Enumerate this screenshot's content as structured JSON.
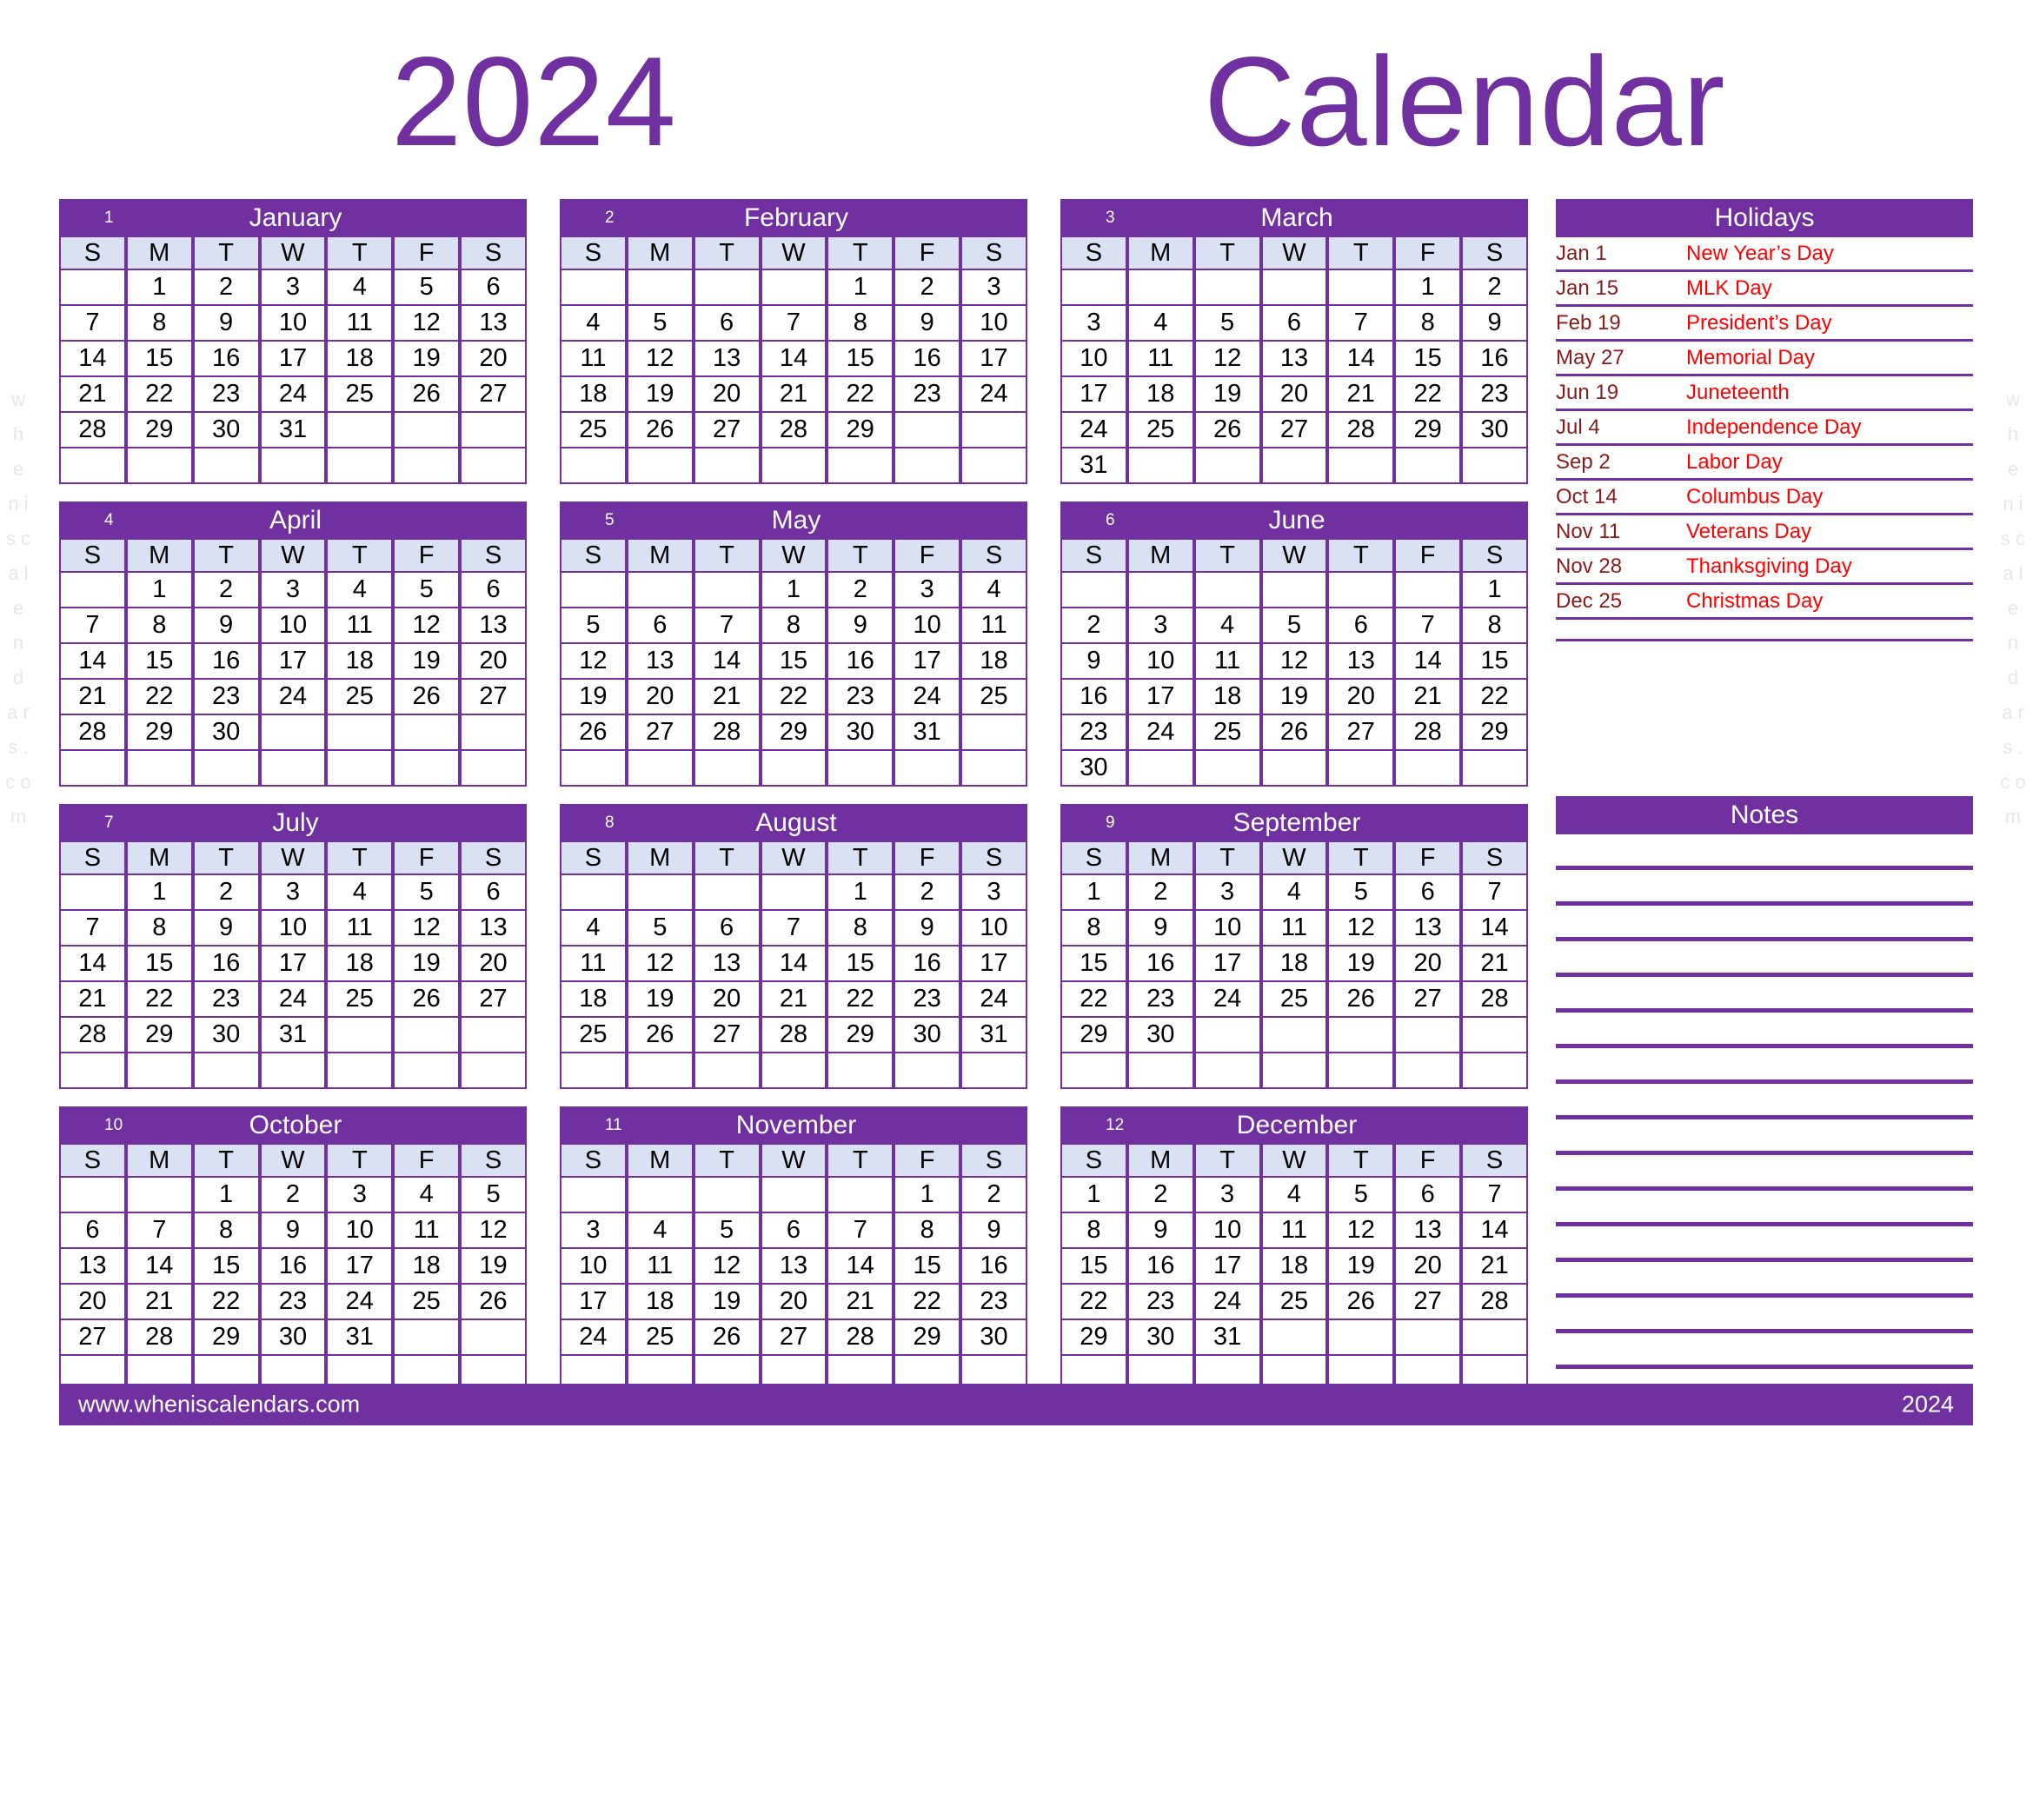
{
  "title": {
    "year": "2024",
    "word": "Calendar"
  },
  "weekdays": [
    "S",
    "M",
    "T",
    "W",
    "T",
    "F",
    "S"
  ],
  "colors": {
    "purple": "#7030A0",
    "weekday_bar": "#D9E1F2",
    "sunday_red": "#FF0000",
    "saturday_blue": "#5B9BD5",
    "holiday_red": "#FF0000",
    "holiday_date": "#8B1A1A"
  },
  "watermark": {
    "left": "w h e n i s c a l e n d a r s . c o m",
    "right": "w h e n i s c a l e n d a r s . c o m"
  },
  "months": [
    {
      "num": "1",
      "name": "January",
      "weeks": [
        [
          "",
          "1",
          "2",
          "3",
          "4",
          "5",
          "6"
        ],
        [
          "7",
          "8",
          "9",
          "10",
          "11",
          "12",
          "13"
        ],
        [
          "14",
          "15",
          "16",
          "17",
          "18",
          "19",
          "20"
        ],
        [
          "21",
          "22",
          "23",
          "24",
          "25",
          "26",
          "27"
        ],
        [
          "28",
          "29",
          "30",
          "31",
          "",
          "",
          ""
        ],
        [
          "",
          "",
          "",
          "",
          "",
          "",
          ""
        ]
      ],
      "holidays": [
        "1",
        "15"
      ]
    },
    {
      "num": "2",
      "name": "February",
      "weeks": [
        [
          "",
          "",
          "",
          "",
          "1",
          "2",
          "3"
        ],
        [
          "4",
          "5",
          "6",
          "7",
          "8",
          "9",
          "10"
        ],
        [
          "11",
          "12",
          "13",
          "14",
          "15",
          "16",
          "17"
        ],
        [
          "18",
          "19",
          "20",
          "21",
          "22",
          "23",
          "24"
        ],
        [
          "25",
          "26",
          "27",
          "28",
          "29",
          "",
          ""
        ],
        [
          "",
          "",
          "",
          "",
          "",
          "",
          ""
        ]
      ],
      "holidays": [
        "19"
      ]
    },
    {
      "num": "3",
      "name": "March",
      "weeks": [
        [
          "",
          "",
          "",
          "",
          "",
          "1",
          "2"
        ],
        [
          "3",
          "4",
          "5",
          "6",
          "7",
          "8",
          "9"
        ],
        [
          "10",
          "11",
          "12",
          "13",
          "14",
          "15",
          "16"
        ],
        [
          "17",
          "18",
          "19",
          "20",
          "21",
          "22",
          "23"
        ],
        [
          "24",
          "25",
          "26",
          "27",
          "28",
          "29",
          "30"
        ],
        [
          "31",
          "",
          "",
          "",
          "",
          "",
          ""
        ]
      ],
      "holidays": []
    },
    {
      "num": "4",
      "name": "April",
      "weeks": [
        [
          "",
          "1",
          "2",
          "3",
          "4",
          "5",
          "6"
        ],
        [
          "7",
          "8",
          "9",
          "10",
          "11",
          "12",
          "13"
        ],
        [
          "14",
          "15",
          "16",
          "17",
          "18",
          "19",
          "20"
        ],
        [
          "21",
          "22",
          "23",
          "24",
          "25",
          "26",
          "27"
        ],
        [
          "28",
          "29",
          "30",
          "",
          "",
          "",
          ""
        ],
        [
          "",
          "",
          "",
          "",
          "",
          "",
          ""
        ]
      ],
      "holidays": []
    },
    {
      "num": "5",
      "name": "May",
      "weeks": [
        [
          "",
          "",
          "",
          "1",
          "2",
          "3",
          "4"
        ],
        [
          "5",
          "6",
          "7",
          "8",
          "9",
          "10",
          "11"
        ],
        [
          "12",
          "13",
          "14",
          "15",
          "16",
          "17",
          "18"
        ],
        [
          "19",
          "20",
          "21",
          "22",
          "23",
          "24",
          "25"
        ],
        [
          "26",
          "27",
          "28",
          "29",
          "30",
          "31",
          ""
        ],
        [
          "",
          "",
          "",
          "",
          "",
          "",
          ""
        ]
      ],
      "holidays": [
        "27"
      ]
    },
    {
      "num": "6",
      "name": "June",
      "weeks": [
        [
          "",
          "",
          "",
          "",
          "",
          "",
          "1"
        ],
        [
          "2",
          "3",
          "4",
          "5",
          "6",
          "7",
          "8"
        ],
        [
          "9",
          "10",
          "11",
          "12",
          "13",
          "14",
          "15"
        ],
        [
          "16",
          "17",
          "18",
          "19",
          "20",
          "21",
          "22"
        ],
        [
          "23",
          "24",
          "25",
          "26",
          "27",
          "28",
          "29"
        ],
        [
          "30",
          "",
          "",
          "",
          "",
          "",
          ""
        ]
      ],
      "holidays": [
        "19"
      ]
    },
    {
      "num": "7",
      "name": "July",
      "weeks": [
        [
          "",
          "1",
          "2",
          "3",
          "4",
          "5",
          "6"
        ],
        [
          "7",
          "8",
          "9",
          "10",
          "11",
          "12",
          "13"
        ],
        [
          "14",
          "15",
          "16",
          "17",
          "18",
          "19",
          "20"
        ],
        [
          "21",
          "22",
          "23",
          "24",
          "25",
          "26",
          "27"
        ],
        [
          "28",
          "29",
          "30",
          "31",
          "",
          "",
          ""
        ],
        [
          "",
          "",
          "",
          "",
          "",
          "",
          ""
        ]
      ],
      "holidays": [
        "4"
      ]
    },
    {
      "num": "8",
      "name": "August",
      "weeks": [
        [
          "",
          "",
          "",
          "",
          "1",
          "2",
          "3"
        ],
        [
          "4",
          "5",
          "6",
          "7",
          "8",
          "9",
          "10"
        ],
        [
          "11",
          "12",
          "13",
          "14",
          "15",
          "16",
          "17"
        ],
        [
          "18",
          "19",
          "20",
          "21",
          "22",
          "23",
          "24"
        ],
        [
          "25",
          "26",
          "27",
          "28",
          "29",
          "30",
          "31"
        ],
        [
          "",
          "",
          "",
          "",
          "",
          "",
          ""
        ]
      ],
      "holidays": []
    },
    {
      "num": "9",
      "name": "September",
      "weeks": [
        [
          "1",
          "2",
          "3",
          "4",
          "5",
          "6",
          "7"
        ],
        [
          "8",
          "9",
          "10",
          "11",
          "12",
          "13",
          "14"
        ],
        [
          "15",
          "16",
          "17",
          "18",
          "19",
          "20",
          "21"
        ],
        [
          "22",
          "23",
          "24",
          "25",
          "26",
          "27",
          "28"
        ],
        [
          "29",
          "30",
          "",
          "",
          "",
          "",
          ""
        ],
        [
          "",
          "",
          "",
          "",
          "",
          "",
          ""
        ]
      ],
      "holidays": [
        "2"
      ]
    },
    {
      "num": "10",
      "name": "October",
      "weeks": [
        [
          "",
          "",
          "1",
          "2",
          "3",
          "4",
          "5"
        ],
        [
          "6",
          "7",
          "8",
          "9",
          "10",
          "11",
          "12"
        ],
        [
          "13",
          "14",
          "15",
          "16",
          "17",
          "18",
          "19"
        ],
        [
          "20",
          "21",
          "22",
          "23",
          "24",
          "25",
          "26"
        ],
        [
          "27",
          "28",
          "29",
          "30",
          "31",
          "",
          ""
        ],
        [
          "",
          "",
          "",
          "",
          "",
          "",
          ""
        ]
      ],
      "holidays": [
        "14"
      ]
    },
    {
      "num": "11",
      "name": "November",
      "weeks": [
        [
          "",
          "",
          "",
          "",
          "",
          "1",
          "2"
        ],
        [
          "3",
          "4",
          "5",
          "6",
          "7",
          "8",
          "9"
        ],
        [
          "10",
          "11",
          "12",
          "13",
          "14",
          "15",
          "16"
        ],
        [
          "17",
          "18",
          "19",
          "20",
          "21",
          "22",
          "23"
        ],
        [
          "24",
          "25",
          "26",
          "27",
          "28",
          "29",
          "30"
        ],
        [
          "",
          "",
          "",
          "",
          "",
          "",
          ""
        ]
      ],
      "holidays": [
        "11",
        "28"
      ]
    },
    {
      "num": "12",
      "name": "December",
      "weeks": [
        [
          "1",
          "2",
          "3",
          "4",
          "5",
          "6",
          "7"
        ],
        [
          "8",
          "9",
          "10",
          "11",
          "12",
          "13",
          "14"
        ],
        [
          "15",
          "16",
          "17",
          "18",
          "19",
          "20",
          "21"
        ],
        [
          "22",
          "23",
          "24",
          "25",
          "26",
          "27",
          "28"
        ],
        [
          "29",
          "30",
          "31",
          "",
          "",
          "",
          ""
        ],
        [
          "",
          "",
          "",
          "",
          "",
          "",
          ""
        ]
      ],
      "holidays": [
        "25"
      ]
    }
  ],
  "holidays_panel": {
    "title": "Holidays",
    "items": [
      {
        "date": "Jan 1",
        "name": "New Year’s Day"
      },
      {
        "date": "Jan 15",
        "name": "MLK Day"
      },
      {
        "date": "Feb 19",
        "name": "President’s Day"
      },
      {
        "date": "May 27",
        "name": "Memorial Day"
      },
      {
        "date": "Jun 19",
        "name": "Juneteenth"
      },
      {
        "date": "Jul 4",
        "name": "Independence Day"
      },
      {
        "date": "Sep 2",
        "name": "Labor Day"
      },
      {
        "date": "Oct 14",
        "name": "Columbus Day"
      },
      {
        "date": "Nov 11",
        "name": "Veterans Day"
      },
      {
        "date": "Nov 28",
        "name": "Thanksgiving Day"
      },
      {
        "date": "Dec 25",
        "name": "Christmas Day"
      }
    ]
  },
  "notes_panel": {
    "title": "Notes",
    "line_count": 15
  },
  "footer": {
    "url": "www.wheniscalendars.com",
    "year": "2024"
  }
}
